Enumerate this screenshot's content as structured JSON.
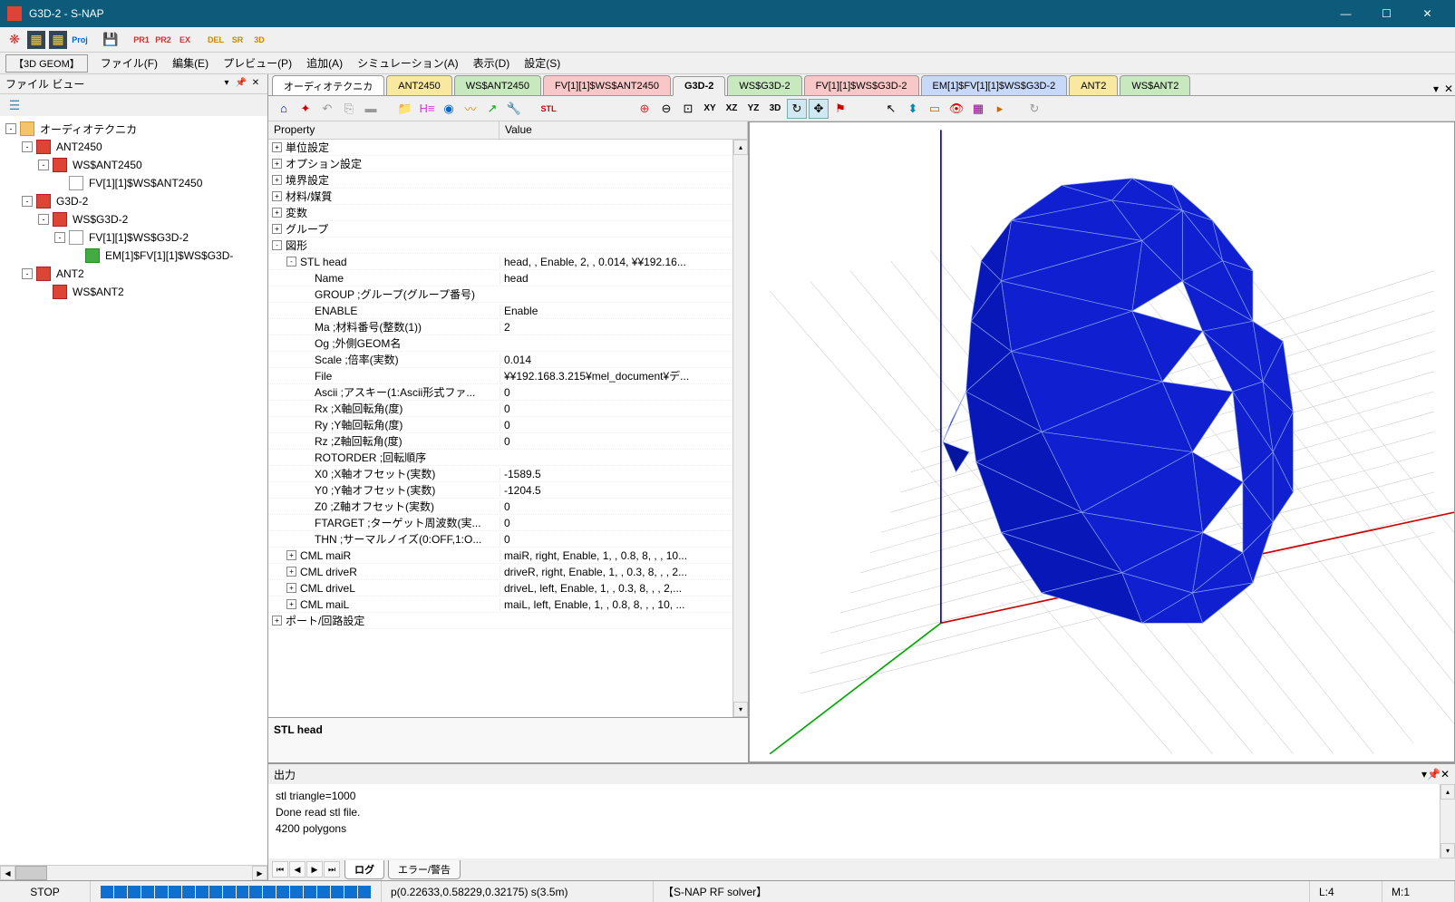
{
  "window": {
    "title": "G3D-2 - S-NAP"
  },
  "menubar": {
    "geom_btn": "【3D GEOM】",
    "items": [
      {
        "label": "ファイル(F)"
      },
      {
        "label": "編集(E)"
      },
      {
        "label": "プレビュー(P)"
      },
      {
        "label": "追加(A)"
      },
      {
        "label": "シミュレーション(A)"
      },
      {
        "label": "表示(D)"
      },
      {
        "label": "設定(S)"
      }
    ]
  },
  "file_view": {
    "title": "ファイル ビュー",
    "tree": [
      {
        "depth": 0,
        "toggle": "-",
        "icon": "folder",
        "label": "オーディオテクニカ"
      },
      {
        "depth": 1,
        "toggle": "-",
        "icon": "red",
        "label": "ANT2450"
      },
      {
        "depth": 2,
        "toggle": "-",
        "icon": "red",
        "label": "WS$ANT2450"
      },
      {
        "depth": 3,
        "toggle": "",
        "icon": "doc",
        "label": "FV[1][1]$WS$ANT2450"
      },
      {
        "depth": 1,
        "toggle": "-",
        "icon": "red",
        "label": "G3D-2"
      },
      {
        "depth": 2,
        "toggle": "-",
        "icon": "red",
        "label": "WS$G3D-2"
      },
      {
        "depth": 3,
        "toggle": "-",
        "icon": "doc",
        "label": "FV[1][1]$WS$G3D-2"
      },
      {
        "depth": 4,
        "toggle": "",
        "icon": "green",
        "label": "EM[1]$FV[1][1]$WS$G3D-"
      },
      {
        "depth": 1,
        "toggle": "-",
        "icon": "red",
        "label": "ANT2"
      },
      {
        "depth": 2,
        "toggle": "",
        "icon": "red",
        "label": "WS$ANT2"
      }
    ]
  },
  "tabs": [
    {
      "label": "オーディオテクニカ",
      "color": "white"
    },
    {
      "label": "ANT2450",
      "color": "yellow"
    },
    {
      "label": "WS$ANT2450",
      "color": "green"
    },
    {
      "label": "FV[1][1]$WS$ANT2450",
      "color": "pink"
    },
    {
      "label": "G3D-2",
      "color": "active"
    },
    {
      "label": "WS$G3D-2",
      "color": "green"
    },
    {
      "label": "FV[1][1]$WS$G3D-2",
      "color": "pink"
    },
    {
      "label": "EM[1]$FV[1][1]$WS$G3D-2",
      "color": "blue"
    },
    {
      "label": "ANT2",
      "color": "yellow"
    },
    {
      "label": "WS$ANT2",
      "color": "green"
    }
  ],
  "property_grid": {
    "header_prop": "Property",
    "header_val": "Value",
    "rows": [
      {
        "indent": 0,
        "toggle": "+",
        "key": "単位設定",
        "val": ""
      },
      {
        "indent": 0,
        "toggle": "+",
        "key": "オプション設定",
        "val": ""
      },
      {
        "indent": 0,
        "toggle": "+",
        "key": "境界設定",
        "val": ""
      },
      {
        "indent": 0,
        "toggle": "+",
        "key": "材料/媒質",
        "val": ""
      },
      {
        "indent": 0,
        "toggle": "+",
        "key": "変数",
        "val": ""
      },
      {
        "indent": 0,
        "toggle": "+",
        "key": "グループ",
        "val": ""
      },
      {
        "indent": 0,
        "toggle": "-",
        "key": "図形",
        "val": ""
      },
      {
        "indent": 1,
        "toggle": "-",
        "key": "STL head",
        "val": "head, , Enable, 2, , 0.014, ¥¥192.16..."
      },
      {
        "indent": 2,
        "toggle": "",
        "key": "Name",
        "val": "head"
      },
      {
        "indent": 2,
        "toggle": "",
        "key": "GROUP ;グループ(グループ番号)",
        "val": ""
      },
      {
        "indent": 2,
        "toggle": "",
        "key": "ENABLE",
        "val": "Enable"
      },
      {
        "indent": 2,
        "toggle": "",
        "key": "Ma ;材料番号(整数(1))",
        "val": "2"
      },
      {
        "indent": 2,
        "toggle": "",
        "key": "Og ;外側GEOM名",
        "val": ""
      },
      {
        "indent": 2,
        "toggle": "",
        "key": "Scale ;倍率(実数)",
        "val": "0.014"
      },
      {
        "indent": 2,
        "toggle": "",
        "key": "File",
        "val": "¥¥192.168.3.215¥mel_document¥デ..."
      },
      {
        "indent": 2,
        "toggle": "",
        "key": "Ascii ;アスキー(1:Ascii形式ファ...",
        "val": "0"
      },
      {
        "indent": 2,
        "toggle": "",
        "key": "Rx ;X軸回転角(度)",
        "val": "0"
      },
      {
        "indent": 2,
        "toggle": "",
        "key": "Ry ;Y軸回転角(度)",
        "val": "0"
      },
      {
        "indent": 2,
        "toggle": "",
        "key": "Rz ;Z軸回転角(度)",
        "val": "0"
      },
      {
        "indent": 2,
        "toggle": "",
        "key": "ROTORDER ;回転順序",
        "val": ""
      },
      {
        "indent": 2,
        "toggle": "",
        "key": "X0 ;X軸オフセット(実数)",
        "val": "-1589.5"
      },
      {
        "indent": 2,
        "toggle": "",
        "key": "Y0 ;Y軸オフセット(実数)",
        "val": "-1204.5"
      },
      {
        "indent": 2,
        "toggle": "",
        "key": "Z0 ;Z軸オフセット(実数)",
        "val": "0"
      },
      {
        "indent": 2,
        "toggle": "",
        "key": "FTARGET ;ターゲット周波数(実...",
        "val": "0"
      },
      {
        "indent": 2,
        "toggle": "",
        "key": "THN ;サーマルノイズ(0:OFF,1:O...",
        "val": "0"
      },
      {
        "indent": 1,
        "toggle": "+",
        "key": "CML maiR",
        "val": "maiR, right, Enable, 1, , 0.8, 8, , , 10..."
      },
      {
        "indent": 1,
        "toggle": "+",
        "key": "CML driveR",
        "val": "driveR, right, Enable, 1, , 0.3, 8, , , 2..."
      },
      {
        "indent": 1,
        "toggle": "+",
        "key": "CML driveL",
        "val": "driveL, left, Enable, 1, , 0.3, 8, , , 2,..."
      },
      {
        "indent": 1,
        "toggle": "+",
        "key": "CML maiL",
        "val": "maiL, left, Enable, 1, , 0.8, 8, , , 10, ..."
      },
      {
        "indent": 0,
        "toggle": "+",
        "key": "ポート/回路設定",
        "val": ""
      }
    ],
    "desc": "STL head"
  },
  "output": {
    "title": "出力",
    "lines": [
      "stl triangle=1000",
      "Done read stl file.",
      "4200 polygons"
    ],
    "tabs": [
      {
        "label": "ログ",
        "active": true
      },
      {
        "label": "エラー/警告",
        "active": false
      }
    ]
  },
  "statusbar": {
    "stop": "STOP",
    "coords": "p(0.22633,0.58229,0.32175) s(3.5m)",
    "solver": "【S-NAP RF solver】",
    "l": "L:4",
    "m": "M:1"
  }
}
